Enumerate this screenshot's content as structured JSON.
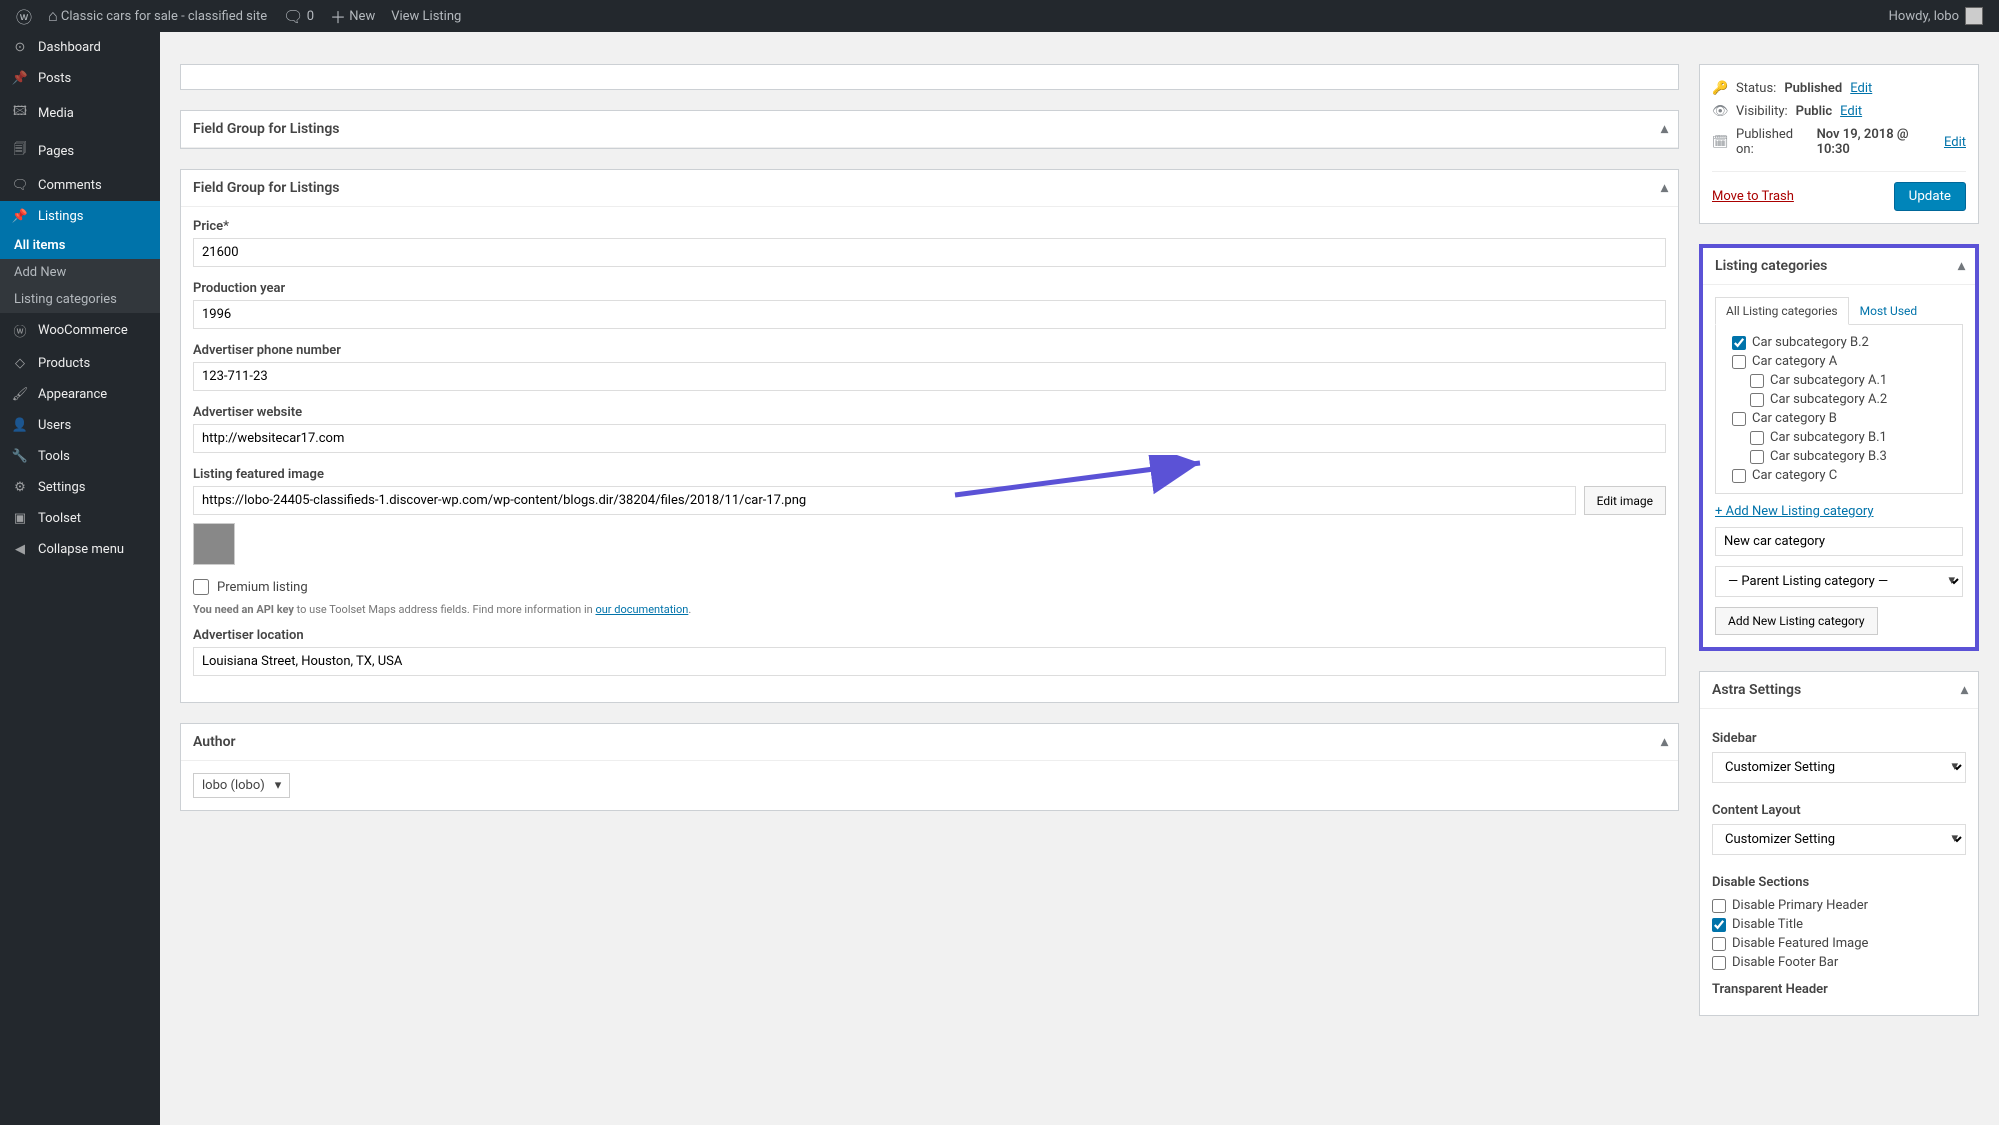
{
  "adminBar": {
    "siteTitle": "Classic cars for sale - classified site",
    "commentsCount": "0",
    "newLabel": "New",
    "viewListingLabel": "View Listing",
    "howdy": "Howdy, lobo"
  },
  "sidebar": {
    "dashboard": "Dashboard",
    "posts": "Posts",
    "media": "Media",
    "pages": "Pages",
    "comments": "Comments",
    "listings": "Listings",
    "allItems": "All items",
    "addNew": "Add New",
    "listingCategories": "Listing categories",
    "woocommerce": "WooCommerce",
    "products": "Products",
    "appearance": "Appearance",
    "users": "Users",
    "tools": "Tools",
    "settings": "Settings",
    "toolset": "Toolset",
    "collapse": "Collapse menu"
  },
  "boxes": {
    "fieldGroup1": "Field Group for Listings",
    "fieldGroup2": "Field Group for Listings",
    "author": "Author",
    "listingCategories": "Listing categories",
    "astra": "Astra Settings"
  },
  "fields": {
    "priceLabel": "Price*",
    "priceValue": "21600",
    "yearLabel": "Production year",
    "yearValue": "1996",
    "phoneLabel": "Advertiser phone number",
    "phoneValue": "123-711-23",
    "websiteLabel": "Advertiser website",
    "websiteValue": "http://websitecar17.com",
    "imageLabel": "Listing featured image",
    "imageValue": "https://lobo-24405-classifieds-1.discover-wp.com/wp-content/blogs.dir/38204/files/2018/11/car-17.png",
    "editImage": "Edit image",
    "premiumLabel": "Premium listing",
    "apiNote1": "You need an API key",
    "apiNote2": " to use Toolset Maps address fields. Find more information in ",
    "apiNoteLink": "our documentation",
    "locationLabel": "Advertiser location",
    "locationValue": "Louisiana Street, Houston, TX, USA"
  },
  "author": {
    "value": "lobo (lobo)"
  },
  "publish": {
    "statusLabel": "Status:",
    "statusValue": "Published",
    "visibilityLabel": "Visibility:",
    "visibilityValue": "Public",
    "publishedLabel": "Published on:",
    "publishedValue": "Nov 19, 2018 @ 10:30",
    "editLabel": "Edit",
    "trash": "Move to Trash",
    "update": "Update"
  },
  "categories": {
    "tabAll": "All Listing categories",
    "tabMost": "Most Used",
    "items": {
      "b2": "Car subcategory B.2",
      "a": "Car category A",
      "a1": "Car subcategory A.1",
      "a2": "Car subcategory A.2",
      "b": "Car category B",
      "b1": "Car subcategory B.1",
      "b3": "Car subcategory B.3",
      "c": "Car category C"
    },
    "addLink": "+ Add New Listing category",
    "newPlaceholder": "New car category",
    "parentPlaceholder": "— Parent Listing category —",
    "addBtn": "Add New Listing category"
  },
  "astra": {
    "sidebarLabel": "Sidebar",
    "sidebarValue": "Customizer Setting",
    "contentLabel": "Content Layout",
    "contentValue": "Customizer Setting",
    "disableSections": "Disable Sections",
    "disablePrimary": "Disable Primary Header",
    "disableTitle": "Disable Title",
    "disableFeatured": "Disable Featured Image",
    "disableFooter": "Disable Footer Bar",
    "transparentHeader": "Transparent Header"
  }
}
